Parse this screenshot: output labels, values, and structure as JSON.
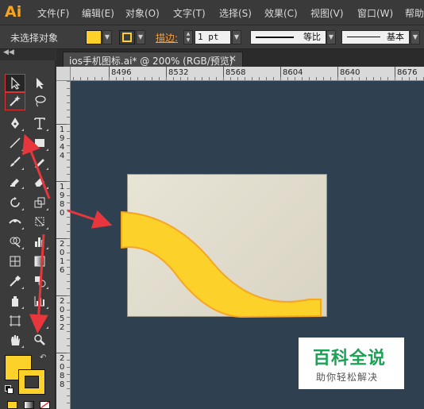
{
  "app": {
    "logo": "Ai"
  },
  "menu": [
    "文件(F)",
    "编辑(E)",
    "对象(O)",
    "文字(T)",
    "选择(S)",
    "效果(C)",
    "视图(V)",
    "窗口(W)",
    "帮助"
  ],
  "control_bar": {
    "selection_status": "未选择对象",
    "fill_color": "#fcd12a",
    "stroke_color": "#fcd12a",
    "stroke_label": "描边:",
    "stroke_weight": "1 pt",
    "stroke_profile": "等比",
    "brush_definition": "基本"
  },
  "document": {
    "tab_title": "ios手机图标.ai* @ 200% (RGB/预览)",
    "tab_close": "✕"
  },
  "rulers": {
    "horizontal": [
      "8496",
      "8532",
      "8568",
      "8604",
      "8640",
      "8676"
    ],
    "vertical": [
      [
        "1",
        "9",
        "4",
        "4"
      ],
      [
        "1",
        "9",
        "8",
        "0"
      ],
      [
        "2",
        "0",
        "1",
        "6"
      ],
      [
        "2",
        "0",
        "5",
        "2"
      ],
      [
        "2",
        "0",
        "8",
        "8"
      ]
    ]
  },
  "tools_panel": {
    "header": "◀◀",
    "selected_tool": "selection-tool",
    "fill_color": "#fcd12a",
    "stroke_color": "#fcd12a",
    "accent_color": "#f7a51b"
  },
  "artwork": {
    "artboard_color": "#e2dece",
    "shape_fill": "#fcd12a",
    "shape_stroke": "#f6a623",
    "canvas_color": "#2f4051"
  },
  "annotations": {
    "arrow_color": "#e8373c"
  },
  "watermark": {
    "title": "百科全说",
    "subtitle": "助你轻松解决"
  }
}
